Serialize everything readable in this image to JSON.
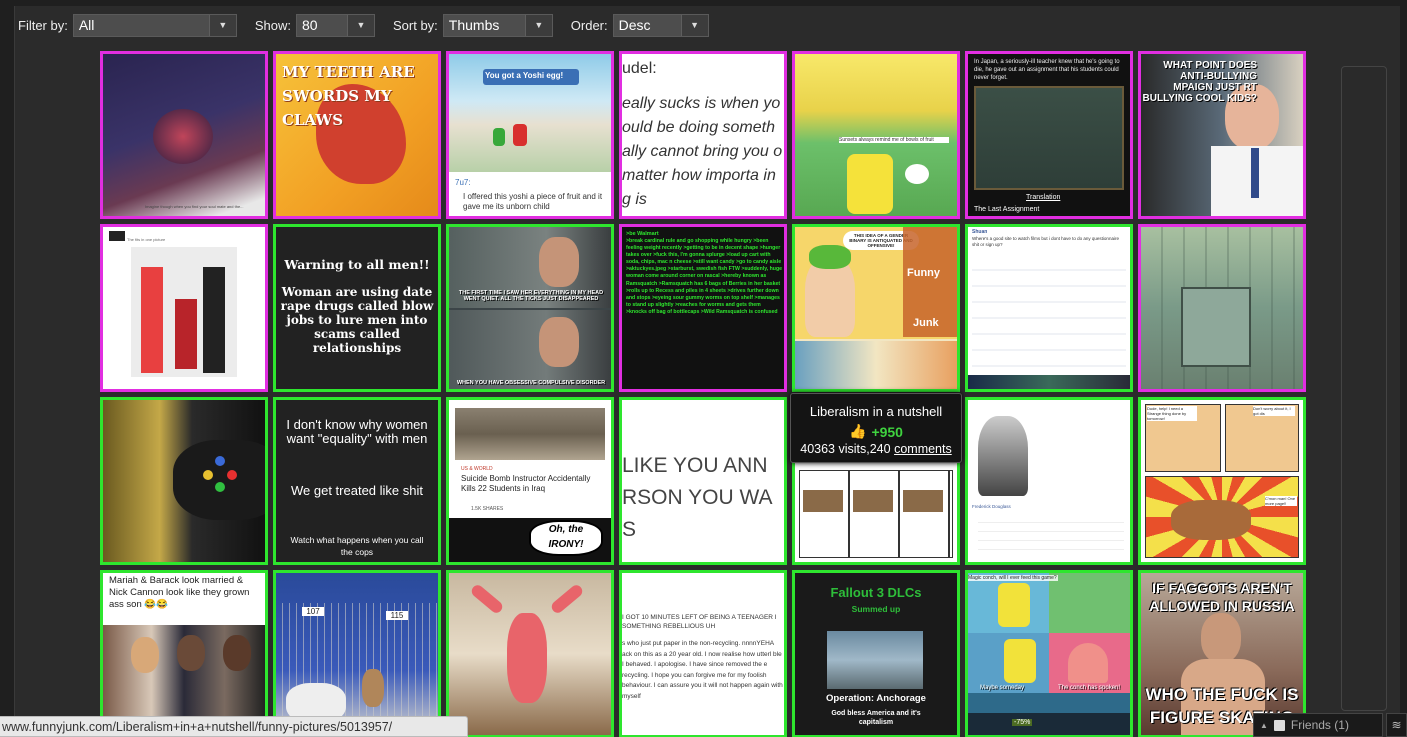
{
  "filters": {
    "filter_label": "Filter by:",
    "filter_value": "All",
    "show_label": "Show:",
    "show_value": "80",
    "sort_label": "Sort by:",
    "sort_value": "Thumbs",
    "order_label": "Order:",
    "order_value": "Desc"
  },
  "colors": {
    "green_border": "#2ee62e",
    "magenta_border": "#e12ee1",
    "background": "#2b2b2b"
  },
  "tiles": [
    {
      "caption": "Imagine though when you find your soul mate and the..."
    },
    {
      "caption": "MY TEETH ARE SWORDS MY CLAWS"
    },
    {
      "caption": "You got a Yoshi egg!",
      "sub": "7u7:",
      "text": "I offered this yoshi a piece of fruit and it gave me its unborn child"
    },
    {
      "caption": "udel:",
      "text": "eally sucks is when yo ould be doing someth ally cannot bring you o matter how importa ing is"
    },
    {
      "caption": "Sunsets always remind me of bowls of fruit"
    },
    {
      "caption": "In Japan, a seriously-ill teacher knew that he's going to die, he gave out an assignment that his students could never forget.",
      "sub": "Translation",
      "text": "The Last Assignment"
    },
    {
      "caption": "WHAT POINT DOES ANTI-BULLYING MPAIGN JUST RT BULLYING COOL KIDS?"
    },
    {
      "caption": "The fits in one picture"
    },
    {
      "caption": "Warning to all men!!",
      "text": "Woman are using date rape drugs called blow jobs to lure men into scams called relationships"
    },
    {
      "caption": "THE FIRST TIME I SAW HER EVERYTHING IN MY HEAD WENT QUIET. ALL THE TICKS JUST DISAPPEARED",
      "text": "WHEN YOU HAVE OBSESSIVE COMPULSIVE DISORDER"
    },
    {
      "caption": ">be Walmart",
      "text": ">break cardinal rule and go shopping while hungry >been feeling weight recently >getting to be in decent shape >hunger takes over >fuck this, I'm gonna splurge >load up cart with soda, chips, mac n cheese >still want candy >go to candy aisle >aktuckyes.jpeg >starburst, swedish fish FTW >suddenly, huge woman come around corner on rascal >hereby known as Ramsquatch >Ramsquatch has 6 bags of Berries in her basket >rolls up to Recess and piles in 4 sheets >drives further down and stops >eyeing sour gummy worms on top shelf >manages to stand up slightly >reaches for worms and gets them >knocks off bag of bottlecaps >Wild Ramsquatch is confused"
    },
    {
      "caption": "THIS IDEA OF A GENDER BINARY IS ANTIQUATED AND OFFENSIVE!",
      "sub": "Funny",
      "text": "Junk"
    },
    {
      "caption": "Shuan",
      "text": "Where's a good site to watch films but i dont have to do any questionnaire shit or sign up?"
    },
    {
      "caption": ""
    },
    {
      "caption": ""
    },
    {
      "caption": "I don't know why women want \"equality\" with men",
      "sub": "We get treated like shit",
      "text": "Watch what happens when you call the cops"
    },
    {
      "caption": "US & WORLD",
      "sub": "Suicide Bomb Instructor Accidentally Kills 22 Students in Iraq",
      "text": "1.5K SHARES",
      "extra": "Oh, the IRONY!"
    },
    {
      "caption": "LIKE YOU ANN RSON YOU WA S"
    },
    {
      "caption": ""
    },
    {
      "caption": "Frederick Douglass"
    },
    {
      "caption": "Dude, help! I need a Strange thing done by tomorrow!",
      "sub": "Don't worry about it, I got dis",
      "text": "C'mon man! One more page!!"
    },
    {
      "caption": "Mariah & Barack look married & Nick Cannon look like they grown ass son 😂😂"
    },
    {
      "caption": "107",
      "sub": "115"
    },
    {
      "caption": ""
    },
    {
      "caption": "I GOT 10 MINUTES LEFT OF BEING A TEENAGER I SOMETHING REBELLIOUS UH",
      "text": "s who just put paper in the non-recycling. nnnnYEHA ack on this as a 20 year old. I now realise how utterl ble I behaved. I apologise. I have since removed the e recycling. I hope you can forgive me for my foolish behaviour. I can assure you it will not happen again with myself"
    },
    {
      "caption": "Fallout 3 DLCs",
      "sub": "Summed up",
      "text": "Operation: Anchorage",
      "extra": "God bless America and it's capitalism"
    },
    {
      "caption": "Magic conch, will I ever feed this game?",
      "sub": "Maybe someday",
      "text": "The conch has spoken!",
      "extra": "-75%"
    },
    {
      "caption": "IF FAGGOTS AREN'T ALLOWED IN RUSSIA",
      "text": "WHO THE FUCK IS FIGURE SKATING"
    }
  ],
  "tooltip": {
    "title": "Liberalism in a nutshell",
    "score": "+950",
    "visits": "40363 visits,",
    "comment_count": "240",
    "comments_link": "comments"
  },
  "status_url": "www.funnyjunk.com/Liberalism+in+a+nutshell/funny-pictures/5013957/",
  "friends": {
    "label": "Friends (1)"
  }
}
